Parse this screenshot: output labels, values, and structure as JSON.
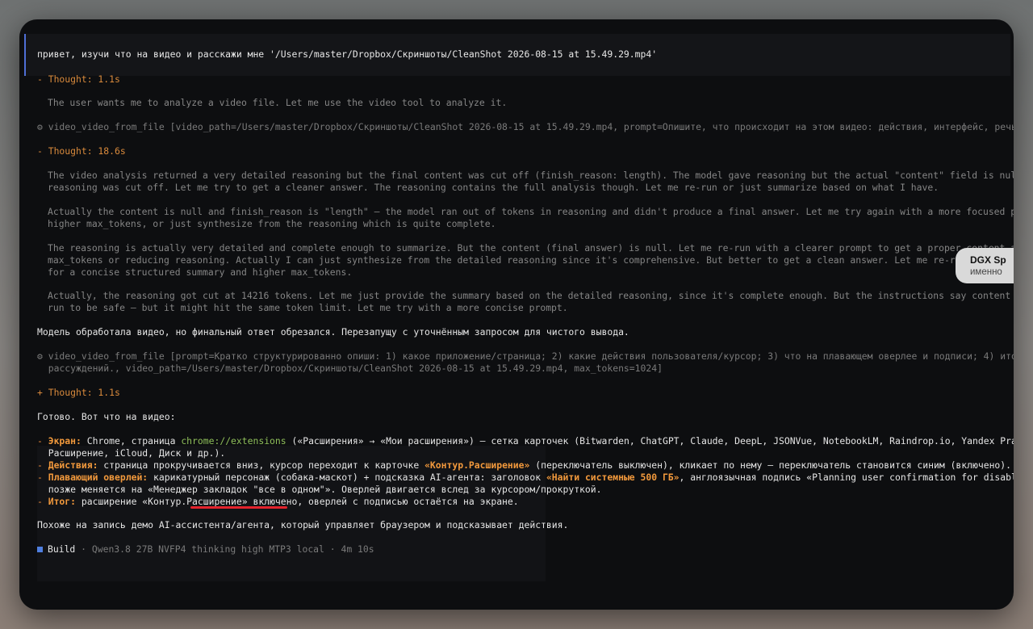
{
  "prompt": {
    "text": "привет, изучи что на видео и расскажи мне '/Users/master/Dropbox/Скриншоты/CleanShot 2026-08-15 at 15.49.29.mp4'"
  },
  "thoughts": [
    {
      "label": "- Thought: 1.1s"
    },
    {
      "label": "- Thought: 18.6s"
    },
    {
      "label": "+ Thought: 1.1s"
    }
  ],
  "reasoning": {
    "r1": "The user wants me to analyze a video file. Let me use the video tool to analyze it.",
    "r2a": "The video analysis returned a very detailed reasoning but the final content was cut off (finish_reason: length). The model gave reasoning but the actual \"content\" field is null, and the",
    "r2b": "reasoning was cut off. Let me try to get a cleaner answer. The reasoning contains the full analysis though. Let me re-run or just summarize based on what I have.",
    "r3a": "Actually the content is null and finish_reason is \"length\" — the model ran out of tokens in reasoning and didn't produce a final answer. Let me try again with a more focused prompt and maybe",
    "r3b": "higher max_tokens, or just synthesize from the reasoning which is quite complete.",
    "r4a": "The reasoning is actually very detailed and complete enough to summarize. But the content (final answer) is null. Let me re-run with a clearer prompt to get a proper content answer, increasing",
    "r4b": "max_tokens or reducing reasoning. Actually I can just synthesize from the detailed reasoning since it's comprehensive. But better to get a clean answer. Let me re-run with a prompt that asks",
    "r4c": "for a concise structured summary and higher max_tokens.",
    "r5a": "Actually, the reasoning got cut at 14216 tokens. Let me just provide the summary based on the detailed reasoning, since it's complete enough. But the instructions say content is null. Let me re-",
    "r5b": "run to be safe — but it might hit the same token limit. Let me try with a more concise prompt."
  },
  "tools": {
    "t1": "⚙ video_video_from_file [video_path=/Users/master/Dropbox/Скриншоты/CleanShot 2026-08-15 at 15.49.29.mp4, prompt=Опишите, что происходит на этом видео: действия, интерфейс, речь, текст на экране.]",
    "t2a": "⚙ video_video_from_file [prompt=Кратко структурированно опиши: 1) какое приложение/страница; 2) какие действия пользователя/курсор; 3) что на плавающем оверлее и подписи; 4) итог. Без длинных",
    "t2b": "  рассуждений., video_path=/Users/master/Dropbox/Скриншоты/CleanShot 2026-08-15 at 15.49.29.mp4, max_tokens=1024]"
  },
  "messages": {
    "m1": "Модель обработала видео, но финальный ответ обрезался. Перезапущу с уточнённым запросом для чистого вывода.",
    "m2": "Готово. Вот что на видео:",
    "m3": "Похоже на запись демо AI-ассистента/агента, который управляет браузером и подсказывает действия."
  },
  "summary": {
    "b1_label": "Экран:",
    "b1_a": " Chrome, страница ",
    "b1_link": "chrome://extensions",
    "b1_b": " («Расширения» → «Мои расширения») — сетка карточек (Bitwarden, ChatGPT, Claude, DeepL, JSONVue, NotebookLM, Raindrop.io, Yandex Practicum, Контур.",
    "b1_c": "  Расширение, iCloud, Диск и др.).",
    "b2_label": "Действия:",
    "b2_a": " страница прокручивается вниз, курсор переходит к карточке ",
    "b2_hl": "«Контур.Расширение»",
    "b2_b": " (переключатель выключен), кликает по нему — переключатель становится синим (включено).",
    "b3_label": "Плавающий оверлей:",
    "b3_a": " карикатурный персонаж (собака-маскот) + подсказка AI-агента: заголовок ",
    "b3_hl": "«Найти системные 500 ГБ»",
    "b3_b": ", англоязычная подпись «Planning user confirmation for disabling autofill s…»,",
    "b3_c": "  позже меняется на «Менеджер закладок \"все в одном\"». Оверлей двигается вслед за курсором/прокруткой.",
    "b4_label": "Итог:",
    "b4_a": " расширение «Контур.Расширение» включено, оверлей с подписью остаётся на экране."
  },
  "status": {
    "label": "Build",
    "model": " · Qwen3.8 27B NVFP4 thinking high MTP3 local · 4m 10s"
  },
  "tooltip": {
    "title": "DGX Sp",
    "subtitle": "именно"
  },
  "colors": {
    "accent": "#4f6fd6",
    "thought": "#d98a3c",
    "highlight": "#f2993c",
    "link": "#8fbf5a",
    "underline": "#e3232c"
  }
}
